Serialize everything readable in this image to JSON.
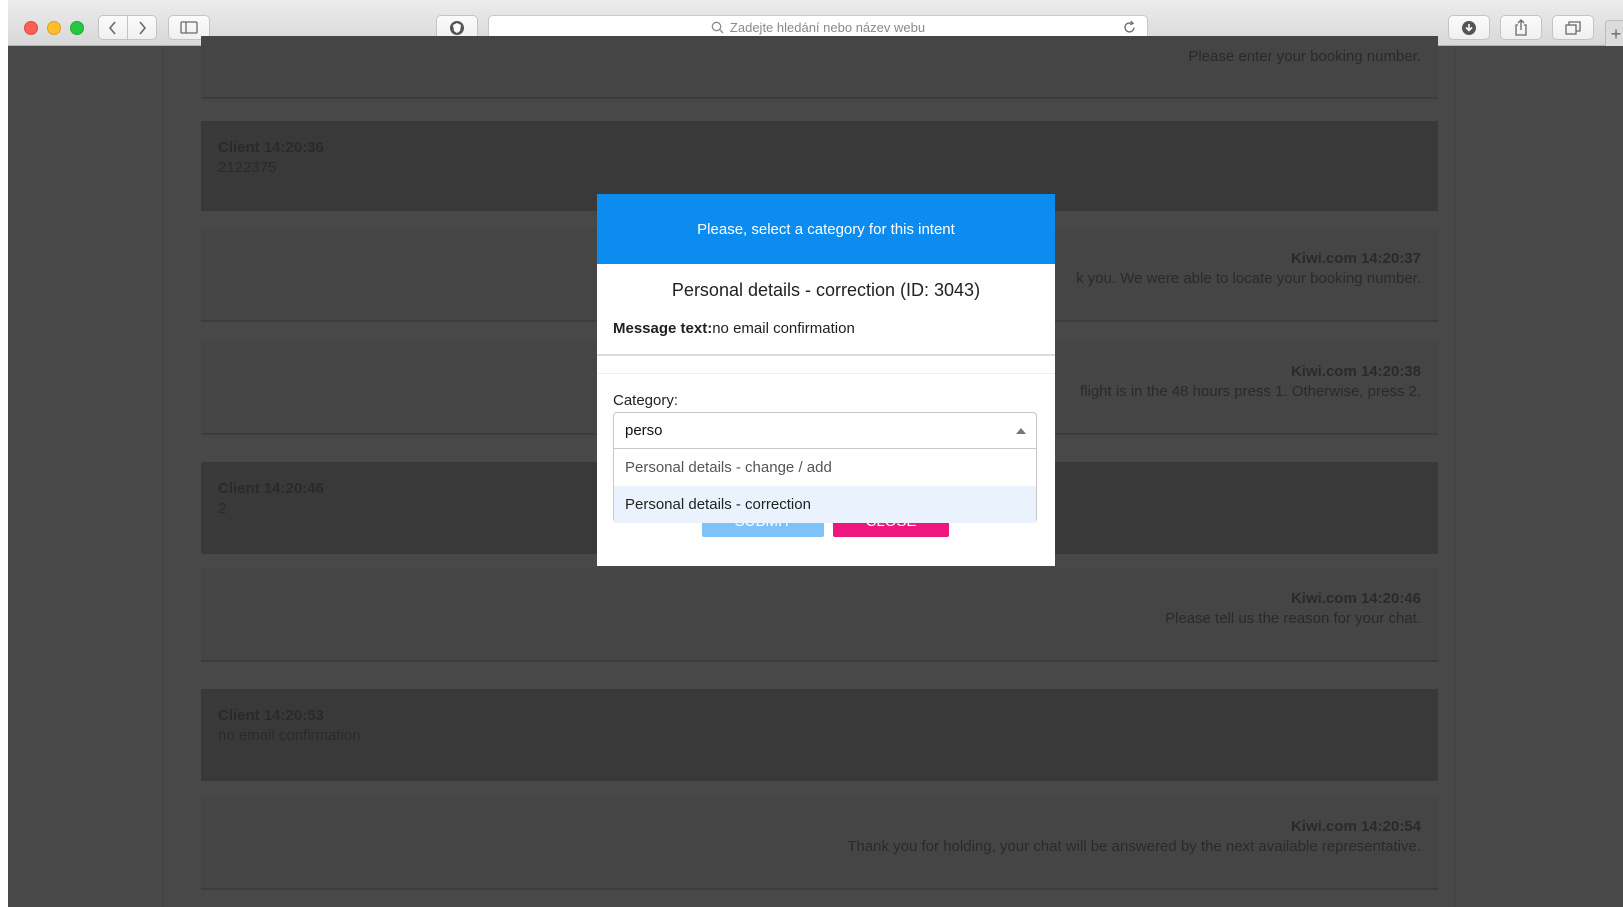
{
  "browser": {
    "address_placeholder": "Zadejte hledání nebo název webu"
  },
  "messages": [
    {
      "kind": "agent",
      "who": "",
      "text": "Please enter your booking number."
    },
    {
      "kind": "client",
      "who": "Client 14:20:36",
      "text": "2122375"
    },
    {
      "kind": "agent",
      "who": "Kiwi.com 14:20:37",
      "text": "k you. We were able to locate your booking number."
    },
    {
      "kind": "agent",
      "who": "Kiwi.com 14:20:38",
      "text": "flight is in the 48 hours press 1. Otherwise, press 2."
    },
    {
      "kind": "client",
      "who": "Client 14:20:46",
      "text": "2"
    },
    {
      "kind": "agent",
      "who": "Kiwi.com 14:20:46",
      "text": "Please tell us the reason for your chat."
    },
    {
      "kind": "client",
      "who": "Client 14:20:53",
      "text": "no email confirmation"
    },
    {
      "kind": "agent",
      "who": "Kiwi.com 14:20:54",
      "text": "Thank you for holding, your chat will be answered by the next available representative."
    }
  ],
  "modal": {
    "header": "Please, select a category for this intent",
    "intent_title": "Personal details - correction (ID: 3043)",
    "message_label": "Message text:",
    "message_value": "no email confirmation",
    "category_label": "Category:",
    "category_input": "perso",
    "options": [
      "Personal details - change / add",
      "Personal details - correction"
    ],
    "active_option": "Personal details - correction",
    "submit_label": "SUBMIT",
    "close_label": "CLOSE",
    "colors": {
      "header": "#0d8cf0",
      "submit": "#7dc3f7",
      "close": "#ee1780"
    }
  }
}
